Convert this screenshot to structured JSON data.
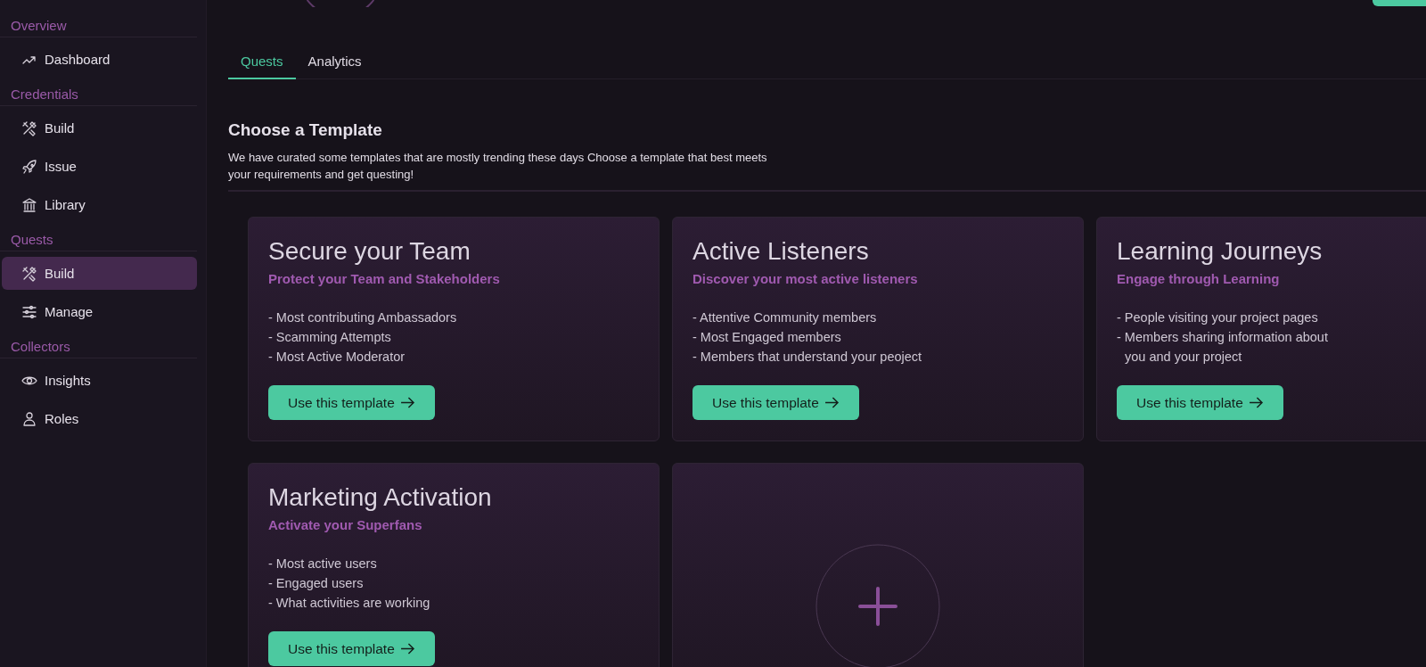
{
  "sidebar": {
    "sections": [
      {
        "title": "Overview",
        "items": [
          {
            "label": "Dashboard",
            "kind": "trend",
            "selected": false
          }
        ]
      },
      {
        "title": "Credentials",
        "items": [
          {
            "label": "Build",
            "kind": "tools",
            "selected": false
          },
          {
            "label": "Issue",
            "kind": "rocket",
            "selected": false
          },
          {
            "label": "Library",
            "kind": "bank",
            "selected": false
          }
        ]
      },
      {
        "title": "Quests",
        "items": [
          {
            "label": "Build",
            "kind": "tools",
            "selected": true
          },
          {
            "label": "Manage",
            "kind": "sliders",
            "selected": false
          }
        ]
      },
      {
        "title": "Collectors",
        "items": [
          {
            "label": "Insights",
            "kind": "eye",
            "selected": false
          },
          {
            "label": "Roles",
            "kind": "user",
            "selected": false
          }
        ]
      }
    ]
  },
  "tabs": [
    {
      "label": "Quests",
      "selected": true
    },
    {
      "label": "Analytics",
      "selected": false
    }
  ],
  "heading": "Choose a Template",
  "description": "We have curated some templates that are mostly trending these days Choose a template that best meets your requirements and get questing!",
  "templates": [
    {
      "kind": "template",
      "title": "Secure your Team",
      "subtitle": "Protect your Team and Stakeholders",
      "points": [
        "- Most contributing Ambassadors",
        "- Scamming Attempts",
        "- Most Active Moderator"
      ],
      "button": "Use this template"
    },
    {
      "kind": "template",
      "title": "Active Listeners",
      "subtitle": "Discover your most active listeners",
      "points": [
        "- Attentive Community members",
        "- Most Engaged members",
        "- Members that understand your peoject"
      ],
      "button": "Use this template"
    },
    {
      "kind": "template",
      "title": "Learning Journeys",
      "subtitle": "Engage through Learning",
      "points": [
        "- People visiting your project pages",
        "- Members sharing information about\nyou and your project"
      ],
      "button": "Use this template"
    },
    {
      "kind": "template",
      "title": "Marketing Activation",
      "subtitle": "Activate your Superfans",
      "points": [
        "- Most active users",
        "- Engaged users",
        "- What activities are working"
      ],
      "button": "Use this template"
    },
    {
      "kind": "add"
    }
  ]
}
